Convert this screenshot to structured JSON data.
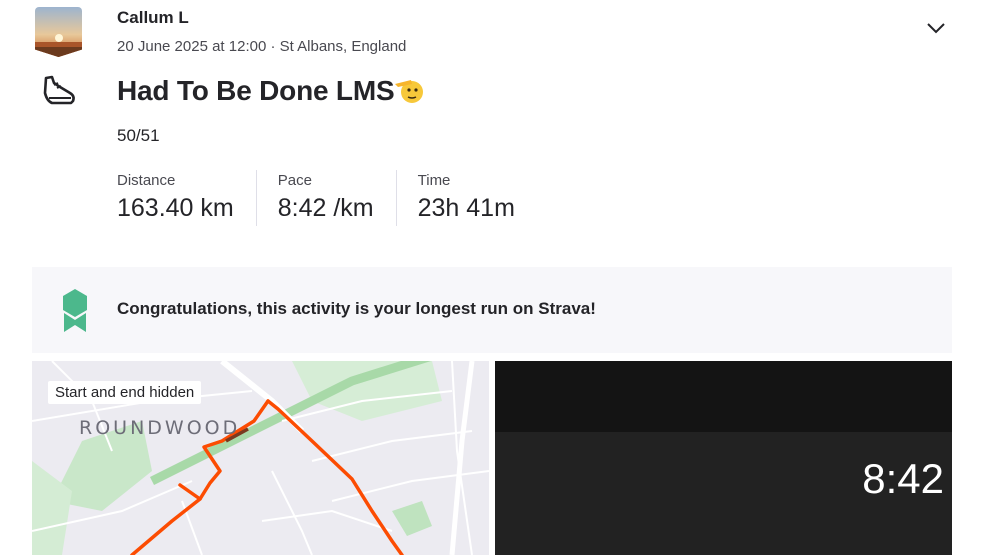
{
  "athlete": {
    "name": "Callum L"
  },
  "activity": {
    "meta": "20 June 2025 at 12:00 · St Albans, England",
    "title": "Had To Be Done LMS",
    "title_emoji": "🫡",
    "description": "50/51",
    "type_icon": "running-shoe-icon",
    "stats": [
      {
        "label": "Distance",
        "value": "163.40 km"
      },
      {
        "label": "Pace",
        "value": "8:42 /km"
      },
      {
        "label": "Time",
        "value": "23h 41m"
      }
    ]
  },
  "achievement": {
    "icon": "achievement-badge-icon",
    "text": "Congratulations, this activity is your longest run on Strava!",
    "color": "#4cb88c"
  },
  "map": {
    "privacy_tag": "Start and end hidden",
    "area_label": "ROUNDWOOD",
    "route_color": "#fc4c02"
  },
  "video": {
    "pace_overlay": "8:42"
  }
}
